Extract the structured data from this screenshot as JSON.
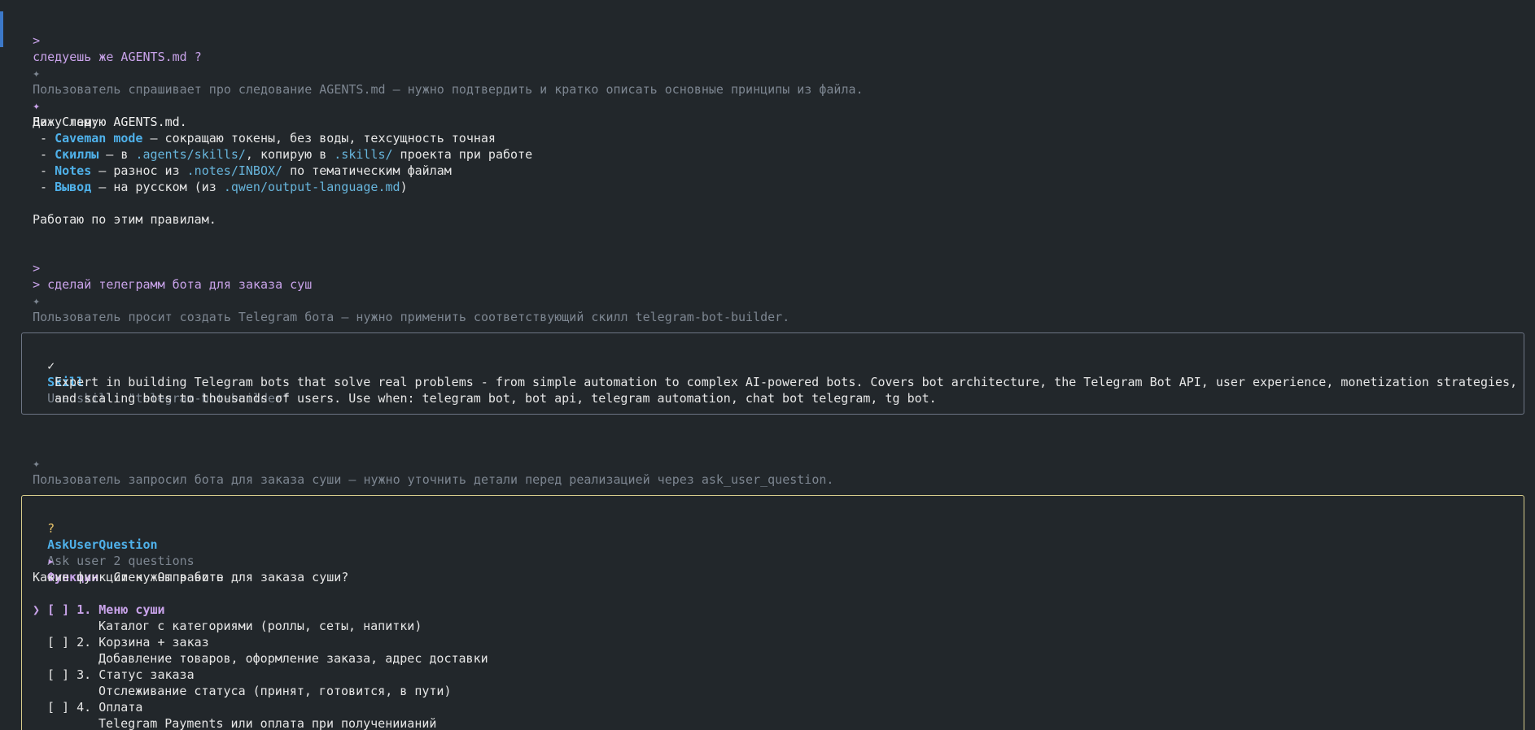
{
  "colors": {
    "background": "#22272b",
    "accent_purple": "#c9a3ea",
    "accent_blue": "#4fb1ea",
    "path_blue": "#67b5dc",
    "dim_text": "#7d8691",
    "skill_border": "#6d7585",
    "ask_border": "#d7cc8c"
  },
  "conversation": {
    "user1": {
      "prompt": ">",
      "text": "следуешь же AGENTS.md ?"
    },
    "thought1": {
      "spark": "✦",
      "text": "Пользователь спрашивает про следование AGENTS.md — нужно подтвердить и кратко описать основные принципы из файла."
    },
    "reply": {
      "spark": "✦",
      "first": "Да. Следую AGENTS.md.",
      "intro": "Вижу там:",
      "bullets": [
        {
          "dash": " - ",
          "term": "Caveman mode",
          "text": " — сокращаю токены, без воды, техсущность точная"
        },
        {
          "dash": " - ",
          "term": "Скиллы",
          "pre": " — в ",
          "path1": ".agents/skills/",
          "mid": ", копирую в ",
          "path2": ".skills/",
          "post": " проекта при работе"
        },
        {
          "dash": " - ",
          "term": "Notes",
          "pre": " — разнос из ",
          "path1": ".notes/INBOX/",
          "post": " по тематическим файлам"
        },
        {
          "dash": " - ",
          "term": "Вывод",
          "pre": " — на русском (из ",
          "path1": ".qwen/output-language.md",
          "post": ")"
        }
      ],
      "closing": "Работаю по этим правилам."
    },
    "user2": {
      "prompt": ">",
      "text": "> сделай телеграмм бота для заказа суш"
    },
    "thought2": {
      "spark": "✦",
      "text": "Пользователь просит создать Telegram бота — нужно применить соответствующий скилл telegram-bot-builder."
    },
    "skill_box": {
      "status": "✓",
      "tool": "Skill",
      "desc": "Use skill: \"telegram-bot-builder\"",
      "body_line1": "Expert in building Telegram bots that solve real problems - from simple automation to complex AI-powered bots. Covers bot architecture, the Telegram Bot API, user experience, monetization strategies,",
      "body_line2": "and scaling bots to thousands of users. Use when: telegram bot, bot api, telegram automation, chat bot telegram, tg bot."
    },
    "thought3": {
      "spark": "✦",
      "text": "Пользователь запросил бота для заказа суши — нужно уточнить детали перед реализацией через ask_user_question."
    },
    "ask_box": {
      "status": "?",
      "tool": "AskUserQuestion",
      "desc": "Ask user 2 questions",
      "arrow": "←",
      "tab_marker": "▸",
      "tabs": [
        "Функции",
        "Стек",
        "Отправить"
      ],
      "question": "Какие функции нужны в боте для заказа суши?",
      "cursor": "❯",
      "options": [
        {
          "box": "[ ]",
          "label": "1. Меню суши",
          "desc": "Каталог с категориями (роллы, сеты, напитки)"
        },
        {
          "box": "[ ]",
          "label": "2. Корзина + заказ",
          "desc": "Добавление товаров, оформление заказа, адрес доставки"
        },
        {
          "box": "[ ]",
          "label": "3. Статус заказа",
          "desc": "Отслеживание статуса (принят, готовится, в пути)"
        },
        {
          "box": "[ ]",
          "label": "4. Оплата",
          "desc": "Telegram Payments или оплата при получениианий"
        }
      ]
    }
  }
}
